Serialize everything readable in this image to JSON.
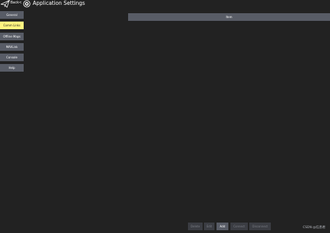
{
  "header": {
    "back_label": "Back",
    "back_chevron": "<",
    "title": "Application Settings",
    "icons": [
      "paper-plane-icon",
      "gear-icon"
    ]
  },
  "sidebar": {
    "items": [
      {
        "label": "General",
        "active": false
      },
      {
        "label": "Comm Links",
        "active": true
      },
      {
        "label": "Offline Maps",
        "active": false
      },
      {
        "label": "MAVLink",
        "active": false
      },
      {
        "label": "Console",
        "active": false
      },
      {
        "label": "Help",
        "active": false
      }
    ]
  },
  "links_list": {
    "column_header": "Item",
    "rows": []
  },
  "actions": {
    "delete_label": "Delete",
    "edit_label": "Edit",
    "add_label": "Add",
    "connect_label": "Connect",
    "disconnect_label": "Disconnect"
  },
  "watermark": "CSDN @信息君",
  "colors": {
    "background": "#222222",
    "button": "#585c66",
    "button_disabled": "#3b3d43",
    "active_highlight": "#fef580",
    "text": "#ffffff"
  }
}
